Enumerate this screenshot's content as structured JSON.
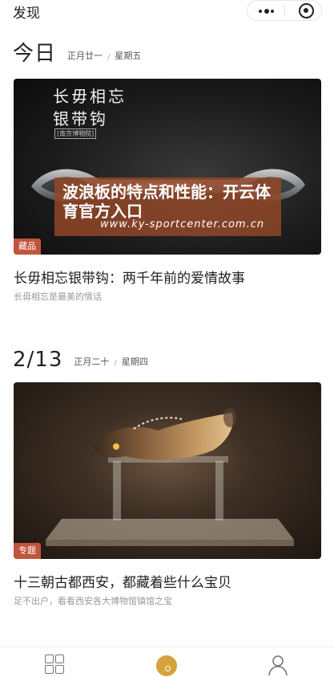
{
  "header": {
    "title": "发现"
  },
  "sections": [
    {
      "date": "今日",
      "lunar": "正月廿一",
      "separator": "/",
      "weekday": "星期五",
      "card": {
        "artwork_title_line1": "长毋相忘",
        "artwork_title_line2": "银带钩",
        "artwork_museum": "[南京博物院]",
        "overlay_text": "波浪板的特点和性能：开云体育官方入口",
        "overlay_url": "www.ky-sportcenter.com.cn",
        "badge": "藏品",
        "title": "长毋相忘银带钩：两千年前的爱情故事",
        "subtitle": "长毋相忘是最美的情话"
      }
    },
    {
      "date": "2/13",
      "lunar": "正月二十",
      "separator": "/",
      "weekday": "星期四",
      "card": {
        "badge": "专题",
        "title": "十三朝古都西安，都藏着些什么宝贝",
        "subtitle": "足不出户，看看西安各大博物馆镇馆之宝"
      }
    }
  ],
  "bottom_nav": {
    "items": [
      {
        "icon": "grid-icon",
        "active": false
      },
      {
        "icon": "home-icon",
        "active": true
      },
      {
        "icon": "user-icon",
        "active": false
      }
    ],
    "active_color": "#d4a43a"
  },
  "colors": {
    "badge": "#c1543c",
    "overlay": "#964828"
  }
}
